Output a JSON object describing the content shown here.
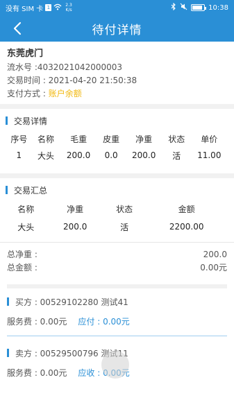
{
  "status_bar": {
    "carrier": "没有 SIM 卡",
    "sim_badge": "1",
    "net_speed_value": "2.3",
    "net_speed_unit": "K/s",
    "time": "10:38",
    "battery_level": 0.9
  },
  "header": {
    "title": "待付详情"
  },
  "info": {
    "shop_name": "东莞虎门",
    "serial": "流水号 :4032021042000003",
    "time": "交易时间 : 2021-04-20 21:50:38",
    "pay_label": "支付方式 : ",
    "pay_value": "账户余额"
  },
  "detail": {
    "title": "交易详情",
    "columns": [
      "序号",
      "名称",
      "毛重",
      "皮重",
      "净重",
      "状态",
      "单价"
    ],
    "rows": [
      [
        "1",
        "大头",
        "200.0",
        "0.0",
        "200.0",
        "活",
        "11.00"
      ]
    ]
  },
  "summary": {
    "title": "交易汇总",
    "columns": [
      "名称",
      "净重",
      "状态",
      "金额"
    ],
    "rows": [
      [
        "大头",
        "200.0",
        "活",
        "2200.00"
      ]
    ]
  },
  "totals": {
    "net_label": "总净重 :",
    "net_value": "200.0",
    "amount_label": "总金额 :",
    "amount_value": "0.00元"
  },
  "buyer": {
    "label": "买方 : 00529102280  测试41",
    "fee": "服务费 : 0.00元",
    "due": "应付 : 0.00元"
  },
  "seller": {
    "label": "卖方 : 00529500796  测试11",
    "fee": "服务费 : 0.00元",
    "due": "应收 : 0.00元"
  },
  "colors": {
    "accent": "#2a8fd6",
    "pay_method": "#f1b80f"
  }
}
